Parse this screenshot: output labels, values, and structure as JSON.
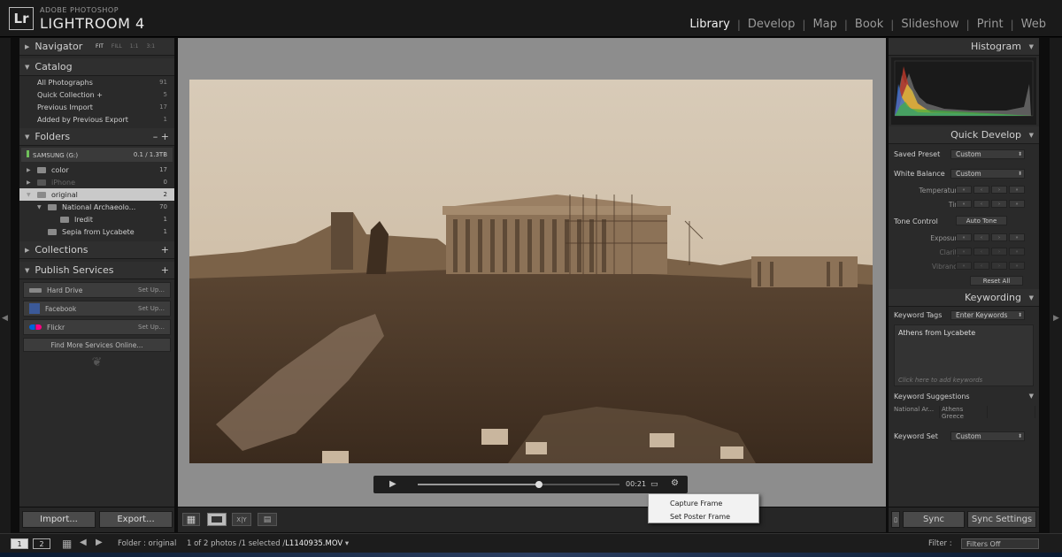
{
  "app": {
    "logo_letters": "Lr",
    "logo_sub": "ADOBE PHOTOSHOP",
    "logo_main": "LIGHTROOM 4"
  },
  "modules": [
    {
      "label": "Library",
      "active": true
    },
    {
      "label": "Develop"
    },
    {
      "label": "Map"
    },
    {
      "label": "Book"
    },
    {
      "label": "Slideshow"
    },
    {
      "label": "Print"
    },
    {
      "label": "Web"
    }
  ],
  "navigator": {
    "title": "Navigator",
    "sizes": [
      "FIT",
      "FILL",
      "1:1",
      "3:1"
    ]
  },
  "catalog": {
    "title": "Catalog",
    "items": [
      {
        "label": "All Photographs",
        "count": "91"
      },
      {
        "label": "Quick Collection +",
        "count": "5"
      },
      {
        "label": "Previous Import",
        "count": "17"
      },
      {
        "label": "Added by Previous Export",
        "count": "1"
      }
    ]
  },
  "folders": {
    "title": "Folders",
    "plus": "–  +",
    "volume": {
      "name": "SAMSUNG (G:)",
      "size": "0.1 / 1.3TB"
    },
    "items": [
      {
        "label": "color",
        "count": "17"
      },
      {
        "label": "iPhone",
        "count": "0"
      },
      {
        "label": "original",
        "count": "2"
      },
      {
        "label": "National Archaeolo...",
        "count": "70"
      },
      {
        "label": "Iredit",
        "count": "1"
      },
      {
        "label": "Sepia from Lycabete",
        "count": "1"
      }
    ]
  },
  "collections": {
    "title": "Collections",
    "plus": "+"
  },
  "publish": {
    "title": "Publish Services",
    "plus": "+",
    "services": [
      {
        "label": "Hard Drive",
        "action": "Set Up..."
      },
      {
        "label": "Facebook",
        "action": "Set Up..."
      },
      {
        "label": "Flickr",
        "action": "Set Up..."
      }
    ],
    "find_more": "Find More Services Online..."
  },
  "left_buttons": {
    "import": "Import...",
    "export": "Export..."
  },
  "video": {
    "time": "00:21",
    "progress": 0.6
  },
  "context_menu": {
    "items": [
      "Capture Frame",
      "Set Poster Frame"
    ]
  },
  "histogram": {
    "title": "Histogram"
  },
  "quick_develop": {
    "title": "Quick Develop",
    "saved_preset_label": "Saved Preset",
    "saved_preset_value": "Custom",
    "white_balance_label": "White Balance",
    "white_balance_value": "Custom",
    "temperature": "Temperature",
    "tint": "Tint",
    "tone_control": "Tone Control",
    "auto_tone": "Auto Tone",
    "exposure": "Exposure",
    "clarity": "Clarity",
    "vibrance": "Vibrance",
    "reset_all": "Reset All"
  },
  "keywording": {
    "title": "Keywording",
    "tags_label": "Keyword Tags",
    "tags_value": "Enter Keywords",
    "keywords": "Athens from Lycabete",
    "hint": "Click here to add keywords",
    "suggestions_title": "Keyword Suggestions",
    "suggestions": [
      "National Ar...",
      "Athens Greece",
      ""
    ],
    "set_label": "Keyword Set",
    "set_value": "Custom"
  },
  "right_buttons": {
    "sync": "Sync",
    "sync_settings": "Sync Settings"
  },
  "filmstrip": {
    "screen1": "1",
    "screen2": "2",
    "source": "Folder : original",
    "status": "1 of 2 photos /1 selected /",
    "filename": "L1140935.MOV",
    "filter_label": "Filter :",
    "filter_value": "Filters Off"
  }
}
